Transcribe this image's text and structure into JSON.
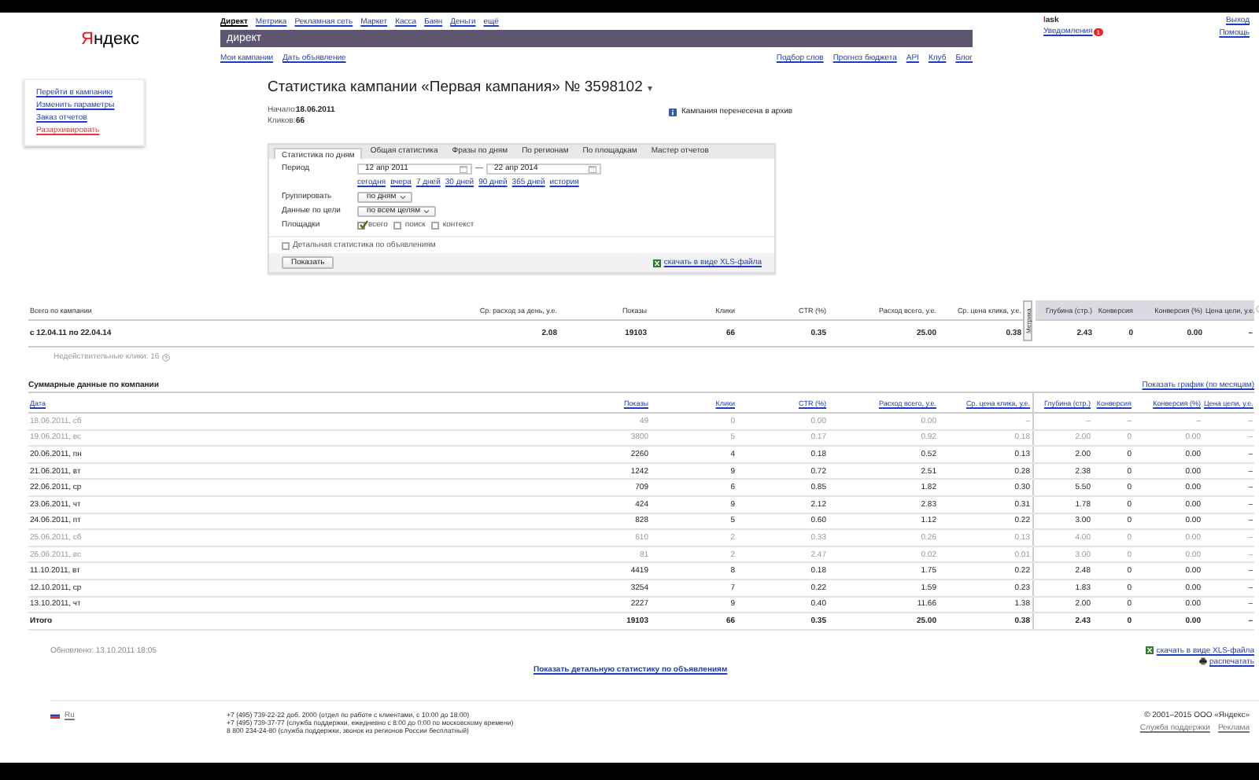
{
  "header": {
    "logo": "Яндекс",
    "services": [
      {
        "label": "Директ",
        "selected": true
      },
      {
        "label": "Метрика",
        "selected": false
      },
      {
        "label": "Рекламная сеть",
        "selected": false
      },
      {
        "label": "Маркет",
        "selected": false
      },
      {
        "label": "Касса",
        "selected": false
      },
      {
        "label": "Баян",
        "selected": false
      },
      {
        "label": "Деньги",
        "selected": false
      },
      {
        "label": "ещё",
        "selected": false
      }
    ],
    "service_title": "директ",
    "login": "lask",
    "notifications": {
      "label": "Уведомления",
      "count": "1"
    },
    "exit": "Выход",
    "help": "Помощь",
    "subnav_left": [
      "Мои кампании",
      "Дать объявление"
    ],
    "subnav_right": [
      "Подбор слов",
      "Прогноз бюджета",
      "API",
      "Клуб",
      "Блог"
    ]
  },
  "sidebar": {
    "links": [
      {
        "label": "Перейти в кампанию",
        "kind": "normal"
      },
      {
        "label": "Изменить параметры",
        "kind": "normal"
      },
      {
        "label": "Заказ отчетов",
        "kind": "normal"
      },
      {
        "label": "Разархивировать",
        "kind": "warning"
      }
    ]
  },
  "campaign": {
    "title": "Статистика кампании «Первая кампания» № 3598102",
    "menu_glyph": "▾",
    "facts": [
      {
        "label": "Начало:",
        "value": "18.06.2011"
      },
      {
        "label": "Кликов:",
        "value": "66"
      }
    ],
    "notice": "Кампания перенесена в архив"
  },
  "report": {
    "tabs": [
      {
        "label": "Статистика по дням",
        "selected": true
      },
      {
        "label": "Общая статистика",
        "selected": false
      },
      {
        "label": "Фразы по дням",
        "selected": false
      },
      {
        "label": "По регионам",
        "selected": false
      },
      {
        "label": "По площадкам",
        "selected": false
      },
      {
        "label": "Мастер отчетов",
        "selected": false
      }
    ],
    "period": {
      "label": "Период",
      "from": "12 апр 2011",
      "separator": "—",
      "to": "22 апр 2014",
      "presets": [
        "сегодня",
        "вчера",
        "7 дней",
        "30 дней",
        "90 дней",
        "365 дней",
        "история"
      ]
    },
    "grouping": {
      "label": "Группировать",
      "value": "по дням"
    },
    "goal": {
      "label": "Данные по цели",
      "value": "по всем целям"
    },
    "platforms": {
      "label": "Площадки",
      "options": [
        {
          "label": "всего",
          "checked": true
        },
        {
          "label": "поиск",
          "checked": false
        },
        {
          "label": "контекст",
          "checked": false
        }
      ]
    },
    "detailed": {
      "label": "Детальная статистика по объявлениям",
      "checked": false
    },
    "submit": "Показать",
    "download": "скачать в виде XLS-файла"
  },
  "summary": {
    "columns": [
      "Всего по кампании",
      "Ср. расход за день, у.е.",
      "Показы",
      "Клики",
      "CTR (%)",
      "Расход всего, у.е.",
      "Ср. цена клика, у.е.",
      "Глубина (стр.)",
      "Конверсия",
      "Конверсия (%)",
      "Цена цели, у.е."
    ],
    "side_tab": "Метрика",
    "row": [
      "с 12.04.11 по 22.04.14",
      "2.08",
      "19103",
      "66",
      "0.35",
      "25.00",
      "0.38",
      "2.43",
      "0",
      "0.00",
      "–"
    ],
    "invalid_clicks": "Недействительные клики: 16"
  },
  "daily": {
    "title": "Суммарные данные по компании",
    "chart_link": "Показать график (по месяцам)",
    "columns": [
      "Дата",
      "Показы",
      "Клики",
      "CTR (%)",
      "Расход всего, у.е.",
      "Ср. цена клика, у.е.",
      "Глубина (стр.)",
      "Конверсия",
      "Конверсия (%)",
      "Цена цели, у.е."
    ],
    "rows": [
      {
        "kind": "day",
        "dimmed": true,
        "cells": [
          "18.06.2011, сб",
          "49",
          "0",
          "0.00",
          "0.00",
          "–",
          "–",
          "–",
          "–",
          "–"
        ]
      },
      {
        "kind": "day",
        "dimmed": true,
        "cells": [
          "19.06.2011, вс",
          "3800",
          "5",
          "0.17",
          "0.92",
          "0.18",
          "2.00",
          "0",
          "0.00",
          "–"
        ]
      },
      {
        "kind": "day",
        "dimmed": false,
        "cells": [
          "20.06.2011, пн",
          "2260",
          "4",
          "0.18",
          "0.52",
          "0.13",
          "2.00",
          "0",
          "0.00",
          "–"
        ]
      },
      {
        "kind": "day",
        "dimmed": false,
        "cells": [
          "21.06.2011, вт",
          "1242",
          "9",
          "0.72",
          "2.51",
          "0.28",
          "2.38",
          "0",
          "0.00",
          "–"
        ]
      },
      {
        "kind": "day",
        "dimmed": false,
        "cells": [
          "22.06.2011, ср",
          "709",
          "6",
          "0.85",
          "1.82",
          "0.30",
          "5.50",
          "0",
          "0.00",
          "–"
        ]
      },
      {
        "kind": "day",
        "dimmed": false,
        "cells": [
          "23.06.2011, чт",
          "424",
          "9",
          "2.12",
          "2.83",
          "0.31",
          "1.78",
          "0",
          "0.00",
          "–"
        ]
      },
      {
        "kind": "day",
        "dimmed": false,
        "cells": [
          "24.06.2011, пт",
          "828",
          "5",
          "0.60",
          "1.12",
          "0.22",
          "3.00",
          "0",
          "0.00",
          "–"
        ]
      },
      {
        "kind": "day",
        "dimmed": true,
        "cells": [
          "25.06.2011, сб",
          "610",
          "2",
          "0.33",
          "0.26",
          "0.13",
          "4.00",
          "0",
          "0.00",
          "–"
        ]
      },
      {
        "kind": "day",
        "dimmed": true,
        "cells": [
          "26.06.2011, вс",
          "81",
          "2",
          "2.47",
          "0.02",
          "0.01",
          "3.00",
          "0",
          "0.00",
          "–"
        ]
      },
      {
        "kind": "day",
        "dimmed": false,
        "cells": [
          "11.10.2011, вт",
          "4419",
          "8",
          "0.18",
          "1.75",
          "0.22",
          "2.48",
          "0",
          "0.00",
          "–"
        ]
      },
      {
        "kind": "day",
        "dimmed": false,
        "cells": [
          "12.10.2011, ср",
          "3254",
          "7",
          "0.22",
          "1.59",
          "0.23",
          "1.83",
          "0",
          "0.00",
          "–"
        ]
      },
      {
        "kind": "day",
        "dimmed": false,
        "cells": [
          "13.10.2011, чт",
          "2227",
          "9",
          "0.40",
          "11.66",
          "1.38",
          "2.00",
          "0",
          "0.00",
          "–"
        ]
      },
      {
        "kind": "total",
        "dimmed": false,
        "cells": [
          "Итого",
          "19103",
          "66",
          "0.35",
          "25.00",
          "0.38",
          "2.43",
          "0",
          "0.00",
          "–"
        ]
      }
    ]
  },
  "updated": "Обновлено: 13.10.2011 18:05",
  "download": "скачать в виде XLS-файла",
  "print": "распечатать",
  "detail_link": "Показать детальную статистику по объявлениям",
  "footer": {
    "lang": "Ru",
    "phones": [
      "+7 (495) 739-22-22 доб. 2000 (отдел по работе с клиентами, с 10:00 до 18:00)",
      "+7 (495) 739-37-77 (служба поддержки, ежедневно с 8:00 до 0:00 по московскому времени)",
      "8 800 234-24-80 (служба поддержки, звонок из регионов России бесплатный)"
    ],
    "copyright": "© 2001–2015 ООО «Яндекс»",
    "links": [
      "Служба поддержки",
      "Реклама"
    ]
  }
}
